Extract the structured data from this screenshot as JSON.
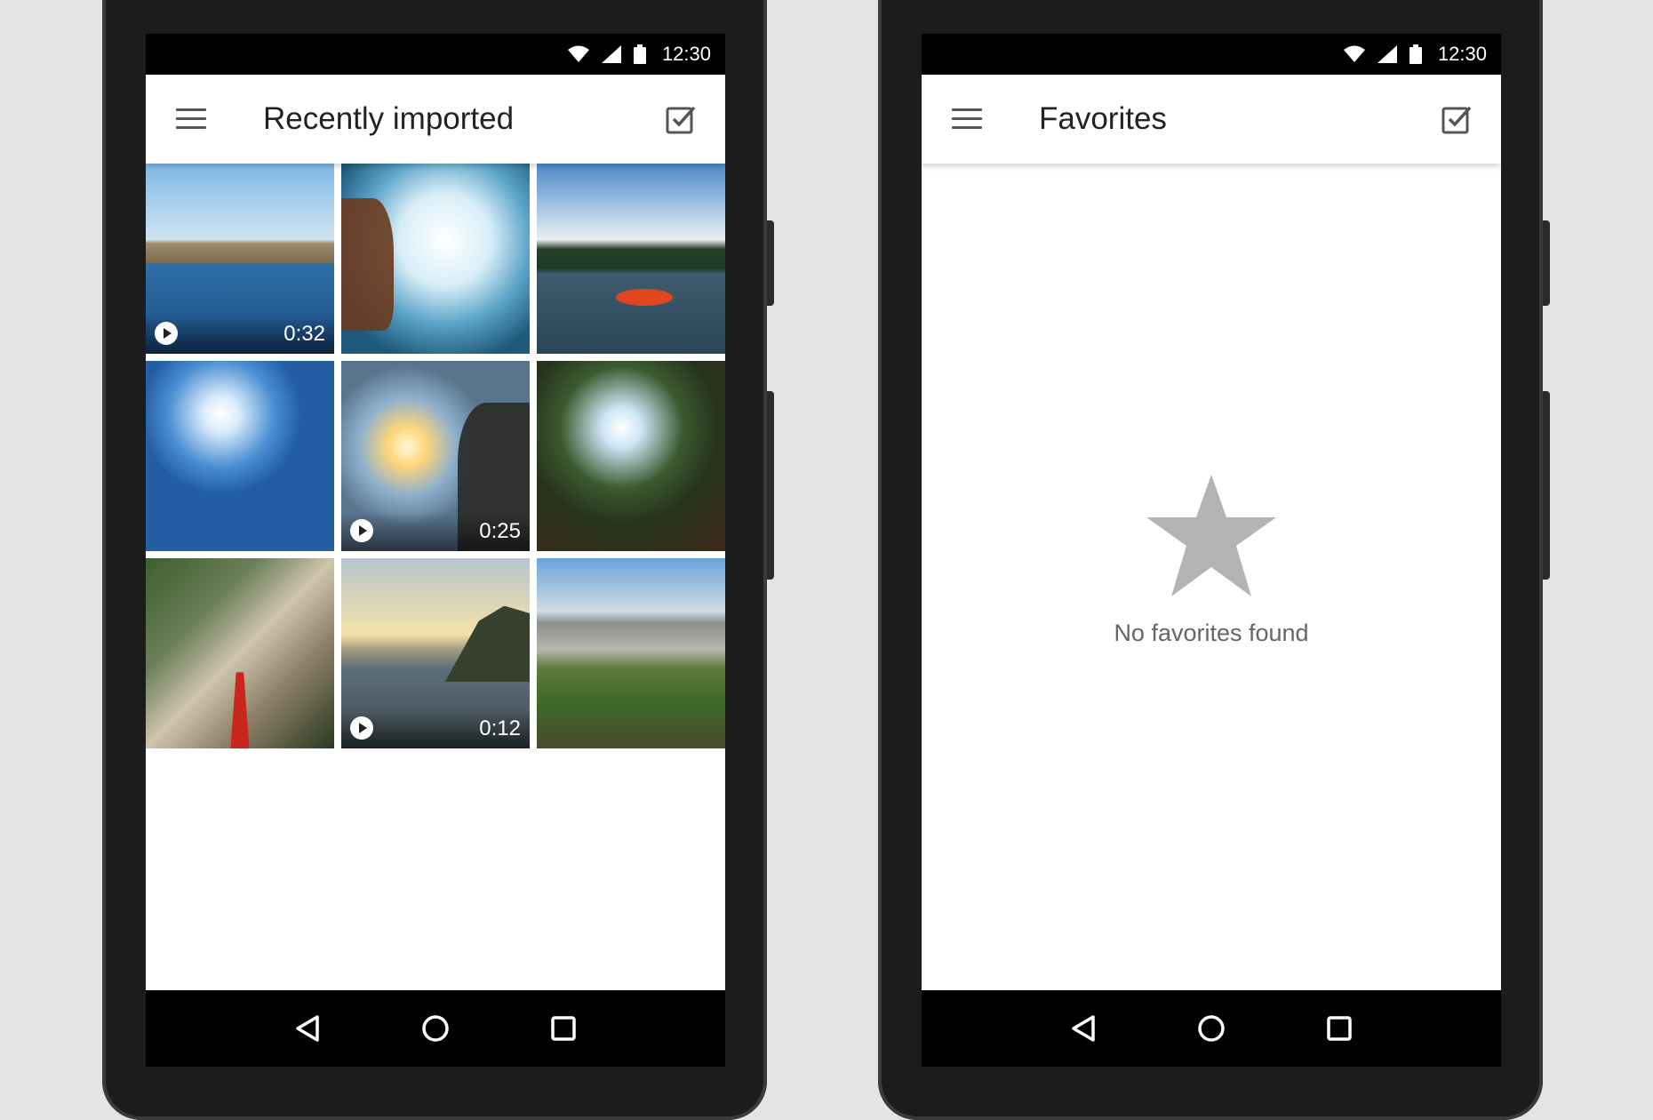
{
  "status_bar": {
    "time": "12:30"
  },
  "left_screen": {
    "title": "Recently imported",
    "tiles": [
      {
        "type": "video",
        "duration": "0:32"
      },
      {
        "type": "photo"
      },
      {
        "type": "photo"
      },
      {
        "type": "photo"
      },
      {
        "type": "video",
        "duration": "0:25"
      },
      {
        "type": "photo"
      },
      {
        "type": "photo"
      },
      {
        "type": "video",
        "duration": "0:12"
      },
      {
        "type": "photo"
      }
    ]
  },
  "right_screen": {
    "title": "Favorites",
    "empty_message": "No favorites found"
  },
  "colors": {
    "app_bar": "#ffffff",
    "icon_gray": "#555555",
    "empty_star": "#b3b3b3"
  },
  "icons": [
    "wifi-icon",
    "signal-icon",
    "battery-icon",
    "menu-icon",
    "select-check-icon",
    "play-icon",
    "back-icon",
    "home-icon",
    "recents-icon",
    "star-icon"
  ]
}
